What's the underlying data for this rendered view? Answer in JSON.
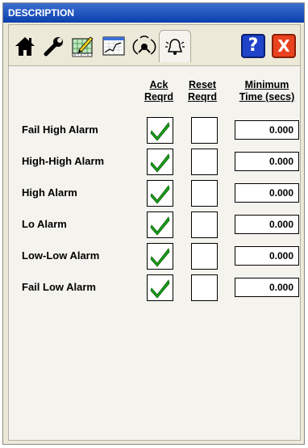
{
  "window": {
    "title": "DESCRIPTION"
  },
  "toolbar": {
    "icons": [
      "home-icon",
      "wrench-icon",
      "chart-edit-icon",
      "trend-icon",
      "satellite-icon",
      "alarm-bell-icon",
      "help-icon",
      "close-icon"
    ],
    "help_label": "?",
    "close_label": "X"
  },
  "columns": {
    "ack": [
      "Ack",
      "Reqrd"
    ],
    "reset": [
      "Reset",
      "Reqrd"
    ],
    "min_time": [
      "Minimum",
      "Time (secs)"
    ]
  },
  "rows": [
    {
      "label": "Fail High Alarm",
      "ack": true,
      "reset": false,
      "time": "0.000"
    },
    {
      "label": "High-High Alarm",
      "ack": true,
      "reset": false,
      "time": "0.000"
    },
    {
      "label": "High Alarm",
      "ack": true,
      "reset": false,
      "time": "0.000"
    },
    {
      "label": "Lo Alarm",
      "ack": true,
      "reset": false,
      "time": "0.000"
    },
    {
      "label": "Low-Low Alarm",
      "ack": true,
      "reset": false,
      "time": "0.000"
    },
    {
      "label": "Fail Low Alarm",
      "ack": true,
      "reset": false,
      "time": "0.000"
    }
  ],
  "colors": {
    "check": "#1aa01a",
    "close": "#e8431e",
    "help": "#1f43c9",
    "titlebar": "#0a3fae"
  }
}
